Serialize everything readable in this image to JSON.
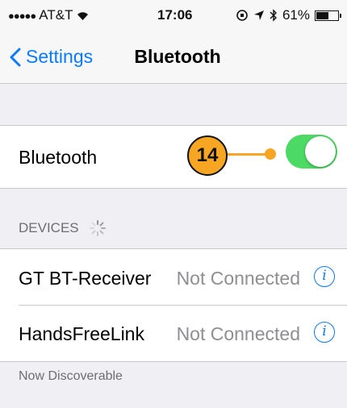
{
  "status_bar": {
    "carrier": "AT&T",
    "time": "17:06",
    "battery": "61%",
    "battery_fraction": 0.61
  },
  "nav": {
    "back_label": "Settings",
    "title": "Bluetooth"
  },
  "bluetooth_row": {
    "label": "Bluetooth",
    "toggle_on": true
  },
  "annotation": {
    "number": "14",
    "color": "#f6a623"
  },
  "devices": {
    "header": "DEVICES",
    "items": [
      {
        "name": "GT BT-Receiver",
        "status": "Not Connected",
        "icon": "info-icon"
      },
      {
        "name": "HandsFreeLink",
        "status": "Not Connected",
        "icon": "info-icon"
      }
    ]
  },
  "footer": "Now Discoverable",
  "colors": {
    "accent": "#0a7aff",
    "toggle_on": "#4cd964",
    "background": "#efeff4"
  }
}
